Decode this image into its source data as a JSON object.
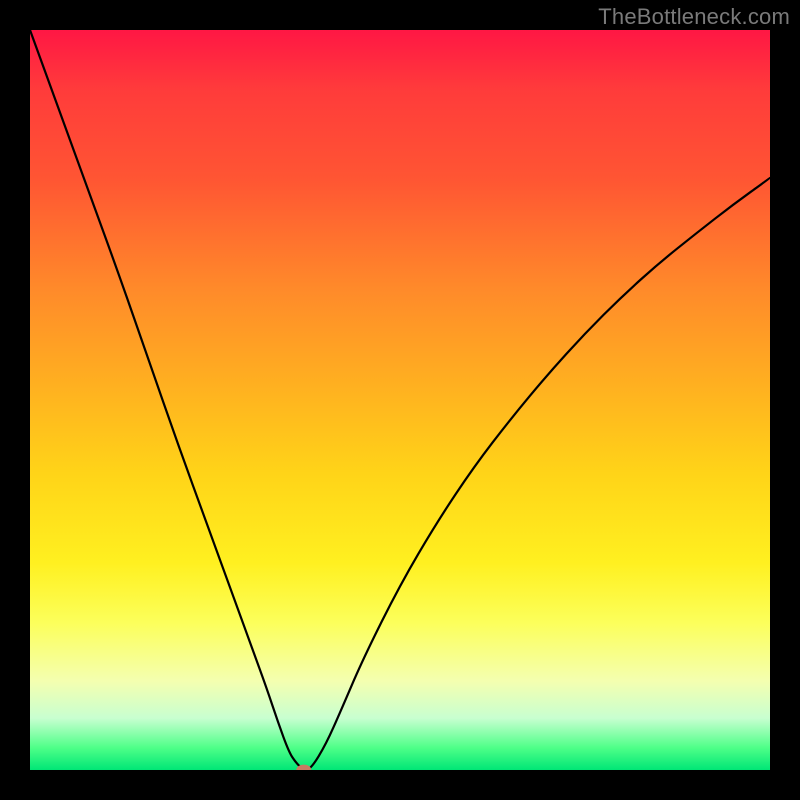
{
  "watermark": "TheBottleneck.com",
  "chart_data": {
    "type": "line",
    "title": "",
    "xlabel": "",
    "ylabel": "",
    "xlim": [
      0,
      100
    ],
    "ylim": [
      0,
      100
    ],
    "x": [
      0,
      4,
      8,
      12,
      16,
      20,
      24,
      28,
      30,
      32,
      33.5,
      35,
      36,
      37,
      38,
      40,
      42,
      45,
      50,
      55,
      60,
      65,
      70,
      75,
      80,
      85,
      90,
      95,
      100
    ],
    "y": [
      100,
      89,
      78,
      67,
      55.5,
      44,
      33,
      22,
      16.5,
      11,
      6.5,
      2.4,
      0.9,
      0,
      0.2,
      3.5,
      8,
      15,
      25,
      33.5,
      41,
      47.5,
      53.5,
      59,
      64,
      68.5,
      72.5,
      76.4,
      80
    ],
    "marker": {
      "x": 37,
      "y": 0
    },
    "gradient_colors": [
      "#ff1744",
      "#ff8a2a",
      "#ffd418",
      "#fcff5a",
      "#00e676"
    ]
  }
}
